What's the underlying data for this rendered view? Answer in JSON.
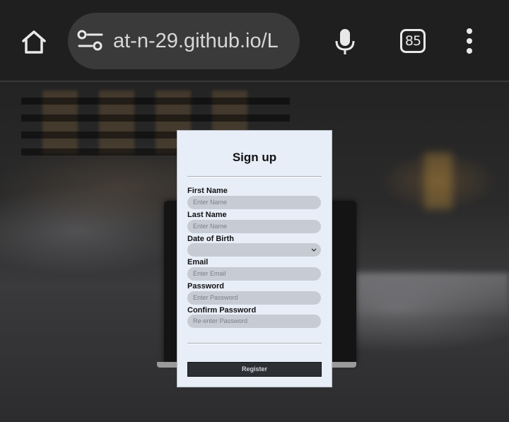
{
  "browser": {
    "url": "at-n-29.github.io/L",
    "tab_count": "85",
    "icons": {
      "home": "home-icon",
      "site_settings": "tune-icon",
      "voice": "mic-icon",
      "tabs": "tab-switcher-icon",
      "menu": "more-vert-icon"
    }
  },
  "signup": {
    "title": "Sign up",
    "fields": [
      {
        "label": "First Name",
        "placeholder": "Enter Name",
        "type": "text"
      },
      {
        "label": "Last Name",
        "placeholder": "Enter Name",
        "type": "text"
      },
      {
        "label": "Date of Birth",
        "placeholder": "",
        "type": "select"
      },
      {
        "label": "Email",
        "placeholder": "Enter Email",
        "type": "email"
      },
      {
        "label": "Password",
        "placeholder": "Enter Password",
        "type": "password"
      },
      {
        "label": "Confirm Password",
        "placeholder": "Re-enter Password",
        "type": "password"
      }
    ],
    "submit_label": "Register"
  },
  "colors": {
    "toolbar_bg": "#1f1f1f",
    "urlbar_bg": "#3a3a3a",
    "card_bg": "#e7eef8",
    "input_bg": "#c7ccd4",
    "button_bg": "#2c2f34"
  }
}
